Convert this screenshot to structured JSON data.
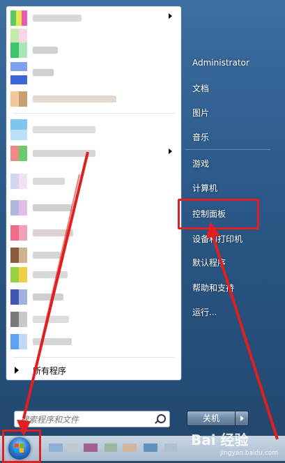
{
  "start_menu": {
    "all_programs_label": "所有程序",
    "search": {
      "placeholder": "搜索程序和文件",
      "value": ""
    },
    "right_items": [
      {
        "label": "Administrator",
        "name": "right-item-administrator"
      },
      {
        "label": "文档",
        "name": "right-item-documents"
      },
      {
        "label": "图片",
        "name": "right-item-pictures"
      },
      {
        "label": "音乐",
        "name": "right-item-music"
      },
      {
        "label": "游戏",
        "name": "right-item-games"
      },
      {
        "label": "计算机",
        "name": "right-item-computer"
      },
      {
        "label": "控制面板",
        "name": "right-item-control-panel"
      },
      {
        "label": "设备和打印机",
        "name": "right-item-devices-printers"
      },
      {
        "label": "默认程序",
        "name": "right-item-default-programs"
      },
      {
        "label": "帮助和支持",
        "name": "right-item-help-support"
      },
      {
        "label": "运行...",
        "name": "right-item-run"
      }
    ],
    "shutdown_label": "关机"
  },
  "watermark": {
    "main": "Bai 经验",
    "sub": "jingyan.baidu.com"
  },
  "icons": {
    "search": "search-icon",
    "start_orb": "windows-start-orb-icon",
    "submenu_arrow": "chevron-right-icon",
    "shutdown_options": "chevron-right-icon"
  },
  "colors": {
    "highlight_box": "#e02020",
    "annotation_arrow": "#e02020",
    "menu_text": "#ffffff",
    "left_pane_bg": "#ffffff"
  }
}
